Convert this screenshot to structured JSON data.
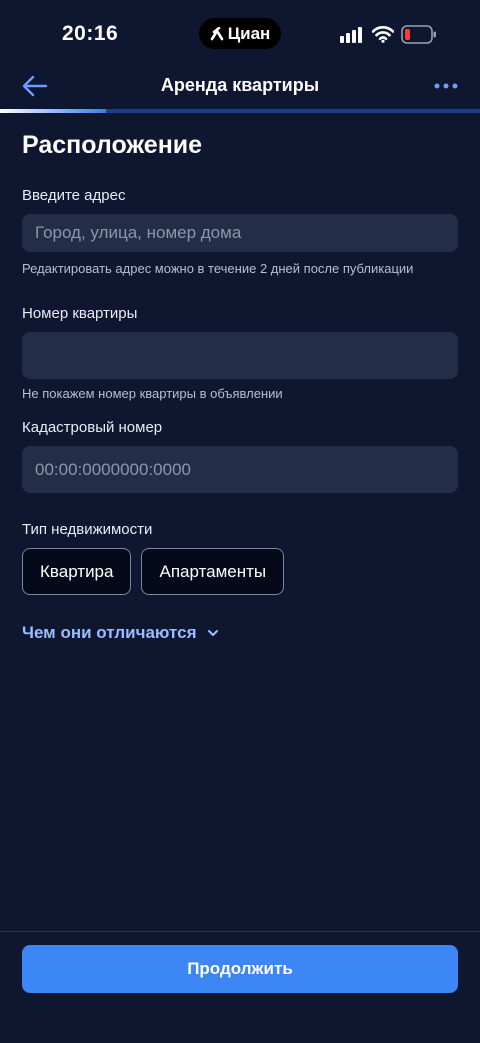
{
  "status_bar": {
    "time": "20:16",
    "island_label": "Циан",
    "icons": [
      "signal-icon",
      "wifi-icon",
      "battery-icon"
    ]
  },
  "nav": {
    "title": "Аренда квартиры",
    "back_icon": "arrow-left-icon",
    "more_icon": "more-icon"
  },
  "progress": {
    "fraction": 0.22
  },
  "form": {
    "title": "Расположение",
    "address": {
      "label": "Введите адрес",
      "placeholder": "Город, улица, номер дома",
      "value": "",
      "hint": "Редактировать адрес можно в течение 2 дней после публикации"
    },
    "apartment_number": {
      "label": "Номер квартиры",
      "placeholder": "",
      "value": "",
      "hint": "Не покажем номер квартиры в объявлении"
    },
    "cadastral_number": {
      "label": "Кадастровый номер",
      "placeholder": "00:00:0000000:0000",
      "value": ""
    },
    "property_type": {
      "label": "Тип недвижимости",
      "options": [
        "Квартира",
        "Апартаменты"
      ]
    },
    "difference_link": "Чем они отличаются"
  },
  "footer": {
    "continue_label": "Продолжить"
  },
  "colors": {
    "background": "#0e1630",
    "accent": "#3c86f5",
    "link": "#9bbcff",
    "input_bg": "#232d47"
  }
}
